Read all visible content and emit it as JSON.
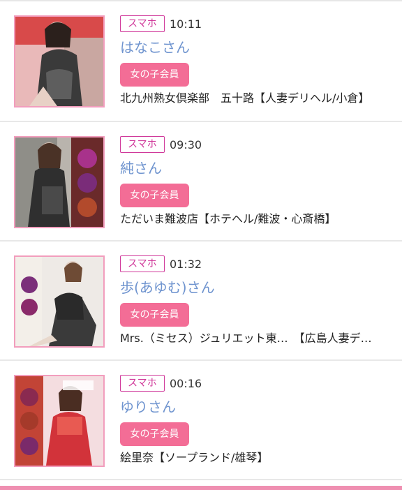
{
  "entries": [
    {
      "device": "スマホ",
      "time": "10:11",
      "name": "はなこさん",
      "badge": "女の子会員",
      "shop": "北九州熟女倶楽部　五十路【人妻デリヘル/小倉】"
    },
    {
      "device": "スマホ",
      "time": "09:30",
      "name": "純さん",
      "badge": "女の子会員",
      "shop": "ただいま難波店【ホテヘル/難波・心斎橋】"
    },
    {
      "device": "スマホ",
      "time": "01:32",
      "name": "歩(あゆむ)さん",
      "badge": "女の子会員",
      "shop": "Mrs.（ミセス）ジュリエット東…　【広島人妻デ…"
    },
    {
      "device": "スマホ",
      "time": "00:16",
      "name": "ゆりさん",
      "badge": "女の子会員",
      "shop": "絵里奈【ソープランド/雄琴】"
    }
  ],
  "colors": {
    "accent": "#f36d96",
    "link": "#6f94cf",
    "device_border": "#d0389a",
    "thumb_border": "#f29dbd"
  }
}
